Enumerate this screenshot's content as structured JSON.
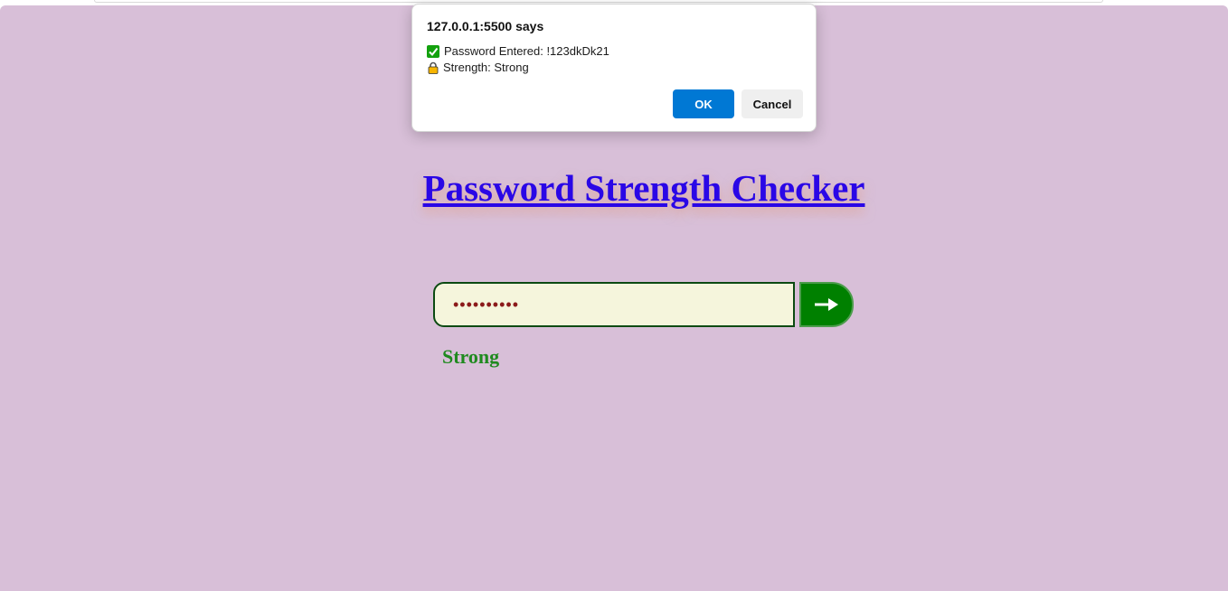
{
  "alert": {
    "origin_title": "127.0.0.1:5500 says",
    "password_line": "Password Entered: !123dkDk21",
    "strength_line": "Strength: Strong",
    "ok_label": "OK",
    "cancel_label": "Cancel",
    "check_icon": "check-mark-button-icon",
    "lock_icon": "locked-padlock-icon"
  },
  "page": {
    "title": "Password Strength Checker",
    "password_value": "!123dkDk21",
    "submit_icon": "right-arrow-icon",
    "strength_result": "Strong"
  },
  "colors": {
    "background": "#d8bfd8",
    "title": "#2a07e6",
    "input_background": "#f5f5dc",
    "button": "#008000",
    "strength": "#1f8a1f",
    "ok_button": "#0078d4"
  }
}
